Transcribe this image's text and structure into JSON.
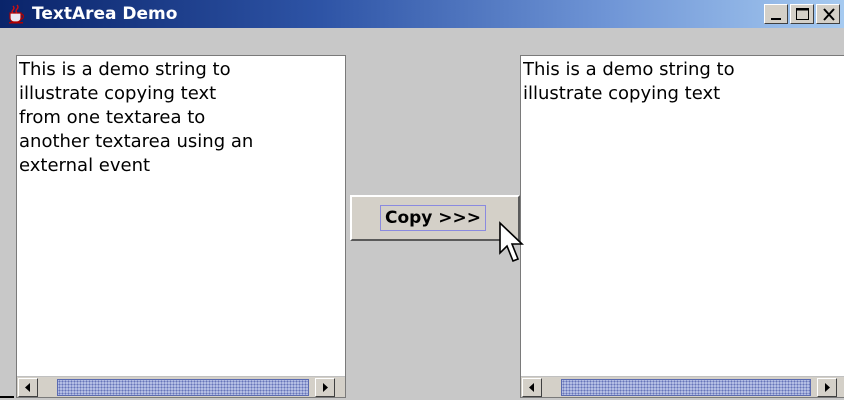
{
  "window": {
    "title": "TextArea Demo",
    "app_icon": "java-coffee-icon",
    "controls": [
      "minimize-icon",
      "maximize-icon",
      "close-icon"
    ]
  },
  "left_textarea": {
    "text": "This is a demo string to\nillustrate copying text\nfrom one textarea to\nanother textarea using an\nexternal event"
  },
  "right_textarea": {
    "text": "This is a demo string to\nillustrate copying text"
  },
  "copy_button": {
    "label": "Copy >>>"
  },
  "colors": {
    "title_gradient_start": "#0a246a",
    "title_gradient_end": "#a6caf0",
    "panel_background": "#c8c8c8",
    "scroll_thumb": "#b7c0e6"
  }
}
